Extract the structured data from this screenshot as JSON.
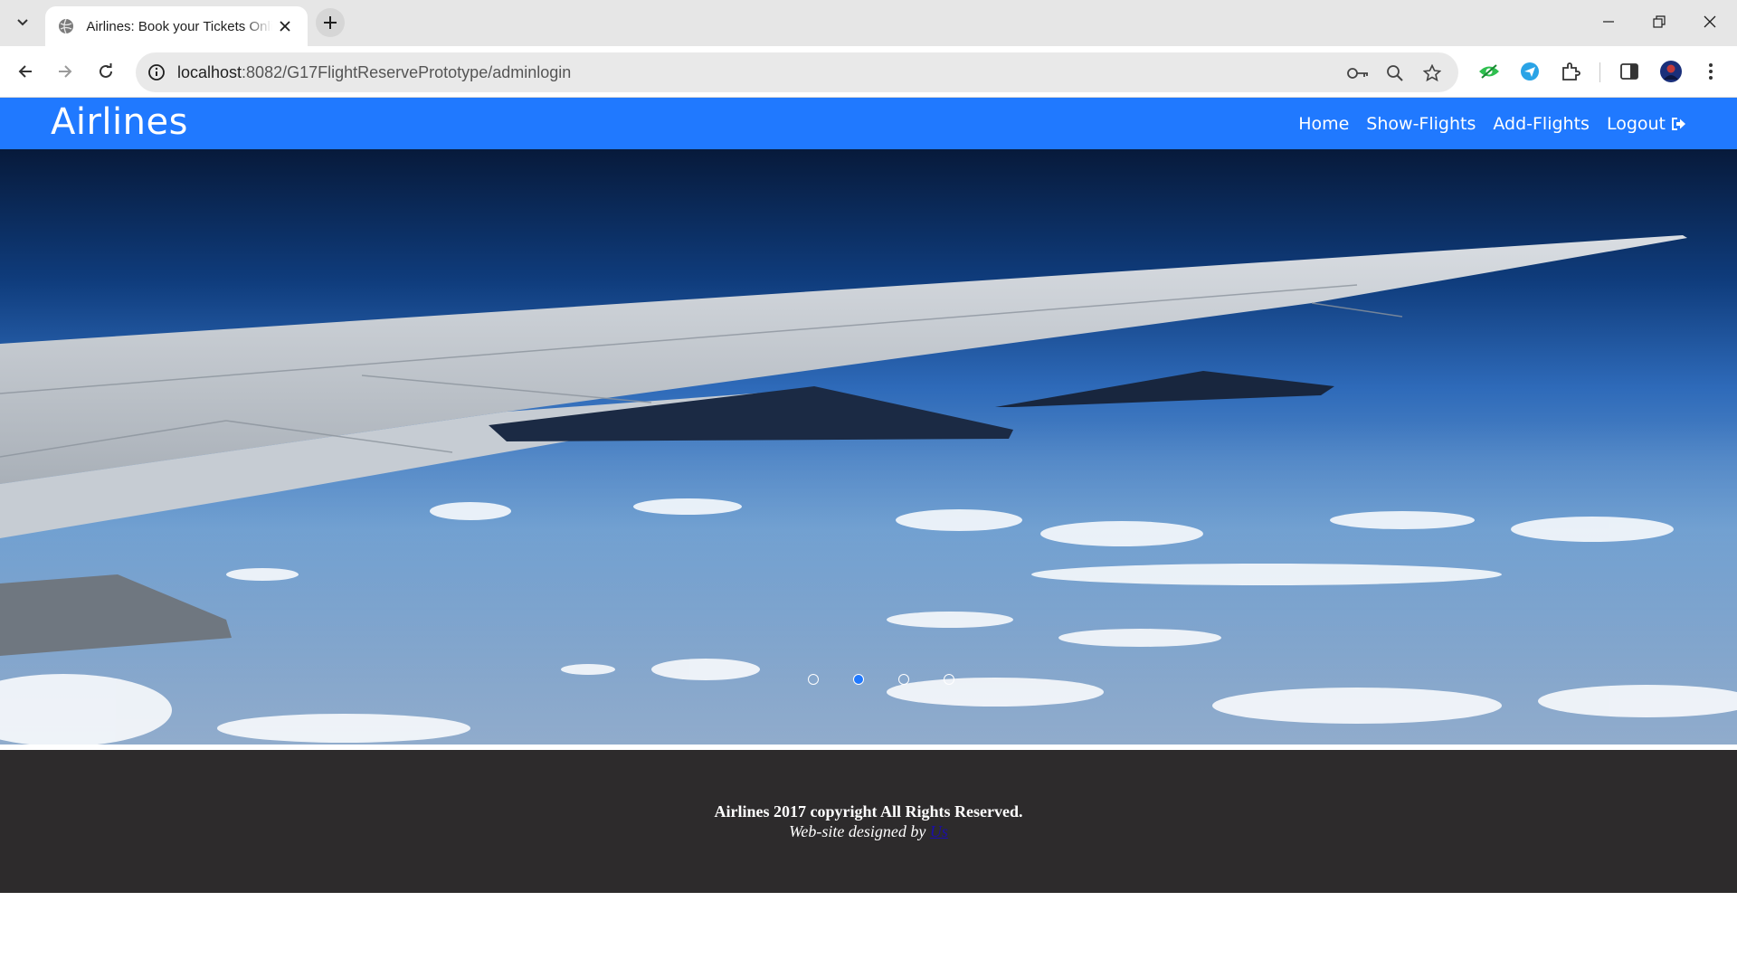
{
  "browser": {
    "tab": {
      "title": "Airlines: Book your Tickets Online"
    },
    "address_bar": {
      "host": "localhost",
      "path": ":8082/G17FlightReservePrototype/adminlogin"
    }
  },
  "navbar": {
    "brand": "Airlines",
    "links": [
      "Home",
      "Show-Flights",
      "Add-Flights",
      "Logout"
    ]
  },
  "carousel": {
    "slide_count": 4,
    "active_index": 1
  },
  "footer": {
    "copyright": "Airlines 2017 copyright All Rights Reserved.",
    "credit_prefix": "Web-site designed by",
    "credit_link": "Us"
  },
  "colors": {
    "navbar": "#2079ff",
    "footer": "#2d2b2c",
    "link": "#1a0dab"
  }
}
